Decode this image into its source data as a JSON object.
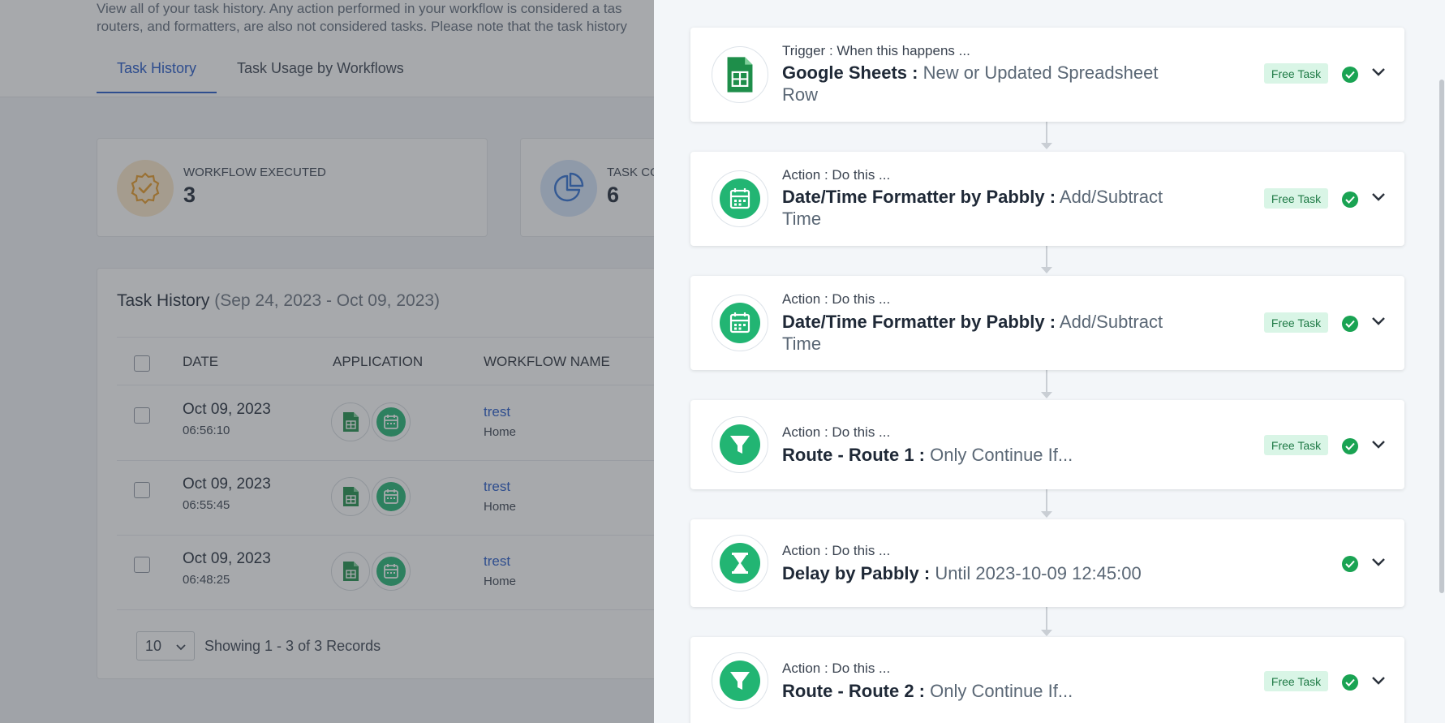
{
  "page": {
    "description_line1": "View all of your task history. Any action performed in your workflow is considered a tas",
    "description_line2": "routers, and formatters, are also not considered tasks. Please note that the task history",
    "tabs": [
      {
        "label": "Task History",
        "active": true
      },
      {
        "label": "Task Usage by Workflows",
        "active": false
      }
    ]
  },
  "stats": [
    {
      "label": "WORKFLOW EXECUTED",
      "value": "3",
      "icon": "badge-check-icon",
      "color": "#f0a83a"
    },
    {
      "label": "TASK CO",
      "value": "6",
      "icon": "pie-chart-icon",
      "color": "#2f6fd4"
    }
  ],
  "history": {
    "title": "Task History",
    "range": "(Sep 24, 2023 - Oct 09, 2023)",
    "columns": [
      "DATE",
      "APPLICATION",
      "WORKFLOW NAME"
    ],
    "rows": [
      {
        "date": "Oct 09, 2023",
        "time": "06:56:10",
        "workflow": "trest",
        "folder": "Home"
      },
      {
        "date": "Oct 09, 2023",
        "time": "06:55:45",
        "workflow": "trest",
        "folder": "Home"
      },
      {
        "date": "Oct 09, 2023",
        "time": "06:48:25",
        "workflow": "trest",
        "folder": "Home"
      }
    ],
    "page_size": "10",
    "showing": "Showing 1 - 3 of 3 Records"
  },
  "drawer": {
    "steps": [
      {
        "sub": "Trigger : When this happens ...",
        "app": "Google Sheets :",
        "event": "New or Updated Spreadsheet Row",
        "icon": "google-sheets-icon",
        "free": "Free Task"
      },
      {
        "sub": "Action : Do this ...",
        "app": "Date/Time Formatter by Pabbly :",
        "event": "Add/Subtract Time",
        "icon": "calendar-icon",
        "free": "Free Task"
      },
      {
        "sub": "Action : Do this ...",
        "app": "Date/Time Formatter by Pabbly :",
        "event": "Add/Subtract Time",
        "icon": "calendar-icon",
        "free": "Free Task"
      },
      {
        "sub": "Action : Do this ...",
        "app": "Route - Route 1 :",
        "event": "Only Continue If...",
        "icon": "filter-icon",
        "free": "Free Task"
      },
      {
        "sub": "Action : Do this ...",
        "app": "Delay by Pabbly :",
        "event": "Until 2023-10-09 12:45:00",
        "icon": "hourglass-icon",
        "free": ""
      },
      {
        "sub": "Action : Do this ...",
        "app": "Route - Route 2 :",
        "event": "Only Continue If...",
        "icon": "filter-icon",
        "free": "Free Task"
      }
    ],
    "colors": {
      "green": "#1aa353",
      "sheets_green": "#1e8e4a",
      "pabbly_green": "#22b573"
    }
  }
}
